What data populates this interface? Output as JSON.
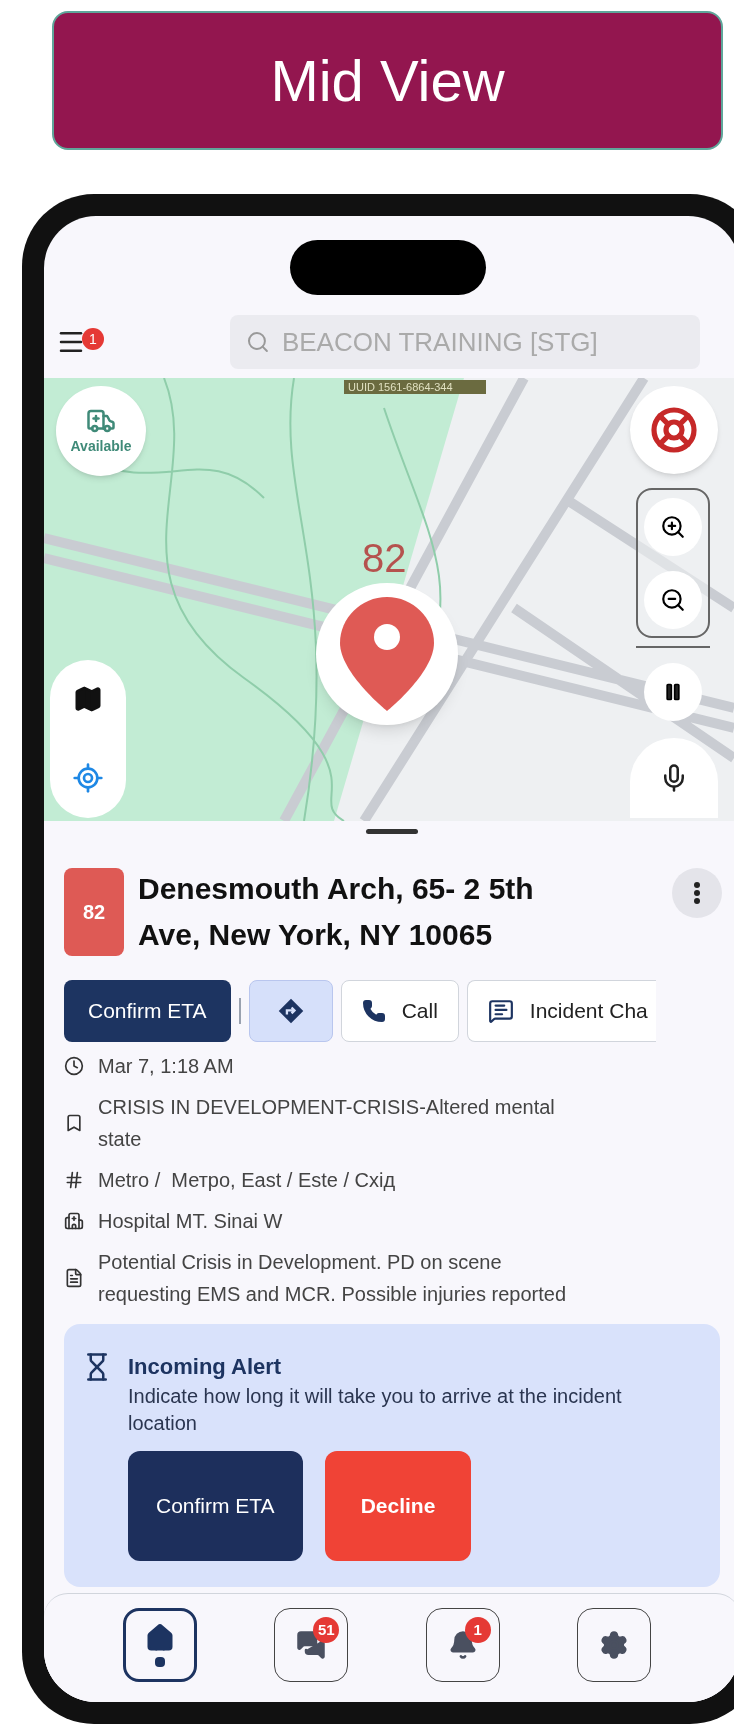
{
  "banner": {
    "title": "Mid View"
  },
  "header": {
    "menu_badge": "1",
    "search": {
      "placeholder": "BEACON TRAINING [STG]"
    }
  },
  "map": {
    "uuid_label": "UUID 1561-6864-344",
    "status_label": "Available",
    "marker_label": "82",
    "playback_paused": false
  },
  "incident": {
    "number": "82",
    "address": "Denesmouth Arch, 65- 2 5th Ave, New York, NY 10065",
    "actions": [
      {
        "kind": "primary",
        "label": "Confirm ETA"
      },
      {
        "kind": "directions"
      },
      {
        "kind": "call",
        "label": "Call"
      },
      {
        "kind": "chat",
        "label": "Incident Cha"
      }
    ],
    "details": [
      {
        "kind": "time",
        "text": "Mar 7, 1:18 AM"
      },
      {
        "kind": "category",
        "text": "CRISIS IN DEVELOPMENT-CRISIS-Altered mental state"
      },
      {
        "kind": "area",
        "text": "Metro /  Метро, East / Este / Схід"
      },
      {
        "kind": "hospital",
        "text": "Hospital MT. Sinai W"
      },
      {
        "kind": "note",
        "text": "Potential Crisis in Development. PD on scene requesting EMS and MCR. Possible injuries reported"
      }
    ],
    "alert": {
      "title": "Incoming Alert",
      "message": "Indicate how long it will take you to arrive at the incident location",
      "buttons": [
        {
          "kind": "confirm",
          "label": "Confirm ETA"
        },
        {
          "kind": "decline",
          "label": "Decline"
        }
      ]
    }
  },
  "nav": [
    {
      "kind": "home",
      "selected": true
    },
    {
      "kind": "chat",
      "selected": false,
      "badge": "51"
    },
    {
      "kind": "alerts",
      "selected": false,
      "badge": "1"
    },
    {
      "kind": "settings",
      "selected": false
    }
  ]
}
